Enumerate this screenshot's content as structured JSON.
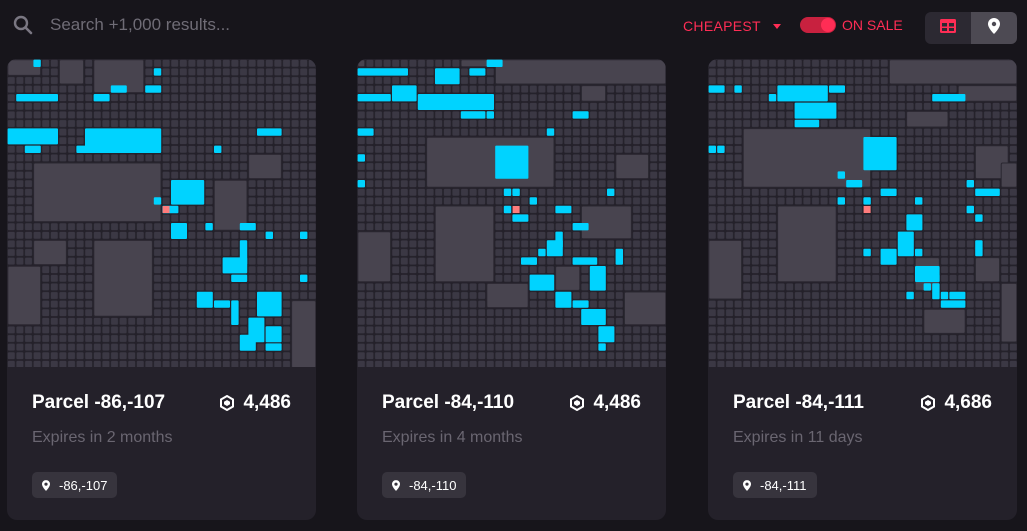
{
  "search": {
    "placeholder": "Search +1,000 results..."
  },
  "sort": {
    "label": "CHEAPEST"
  },
  "filter": {
    "on_sale_label": "ON SALE",
    "on_sale_enabled": true
  },
  "colors": {
    "accent": "#ff2d55",
    "parcel_highlight": "#00d3ff",
    "selected_parcel": "#ff7c7c",
    "map_background": "#363340",
    "card_background": "#24212a"
  },
  "view_modes": [
    "grid",
    "map"
  ],
  "cards": [
    {
      "title": "Parcel -86,-107",
      "price": "4,486",
      "expires": "Expires in 2 months",
      "coords": "-86,-107"
    },
    {
      "title": "Parcel -84,-110",
      "price": "4,486",
      "expires": "Expires in 4 months",
      "coords": "-84,-110"
    },
    {
      "title": "Parcel -84,-111",
      "price": "4,686",
      "expires": "Expires in 11 days",
      "coords": "-84,-111"
    }
  ]
}
